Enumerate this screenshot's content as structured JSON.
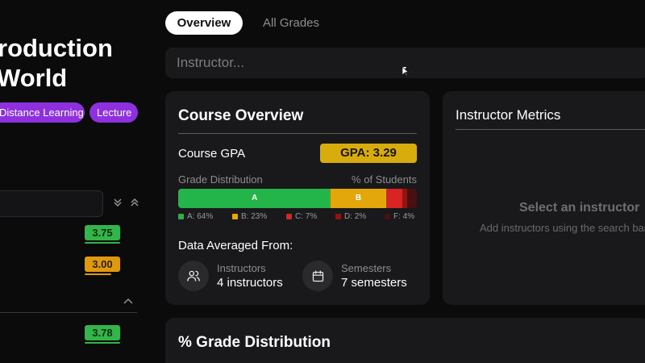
{
  "course": {
    "title_line1": "roduction",
    "title_line2": "World",
    "tags": [
      "Distance Learning",
      "Lecture"
    ]
  },
  "sidebar": {
    "sections": [
      {
        "gpa_values": [
          "3.75",
          "3.00"
        ]
      },
      {
        "gpa_values": [
          "3.78"
        ]
      }
    ]
  },
  "tabs": [
    {
      "label": "Overview",
      "active": true
    },
    {
      "label": "All Grades",
      "active": false
    }
  ],
  "search": {
    "placeholder": "Instructor..."
  },
  "overview": {
    "title": "Course Overview",
    "gpa_label": "Course GPA",
    "gpa_badge": "GPA: 3.29",
    "grade_dist_label": "Grade Distribution",
    "pct_label": "% of Students",
    "distribution": [
      {
        "grade": "A",
        "percent": 64,
        "bar_label": "A",
        "legend": "A: 64%",
        "color": "#23b54a"
      },
      {
        "grade": "B",
        "percent": 23,
        "bar_label": "B",
        "legend": "B: 23%",
        "color": "#e4a70b"
      },
      {
        "grade": "C",
        "percent": 7,
        "bar_label": "",
        "legend": "C: 7%",
        "color": "#d92424"
      },
      {
        "grade": "D",
        "percent": 2,
        "bar_label": "",
        "legend": "D: 2%",
        "color": "#8e1515"
      },
      {
        "grade": "F",
        "percent": 4,
        "bar_label": "",
        "legend": "F: 4%",
        "color": "#4a0f0f"
      }
    ],
    "averaged_label": "Data Averaged From:",
    "instructors_label": "Instructors",
    "instructors_value": "4 instructors",
    "semesters_label": "Semesters",
    "semesters_value": "7 semesters"
  },
  "metrics": {
    "title": "Instructor Metrics",
    "empty_title": "Select an instructor",
    "empty_sub": "Add instructors using the search bar"
  },
  "distribution_section": {
    "title": "% Grade Distribution"
  },
  "colors": {
    "accent_purple": "#8e2fe0",
    "gpa_gold": "#d9ac0e",
    "pill_green": "#33b54a",
    "pill_orange": "#e0990f"
  }
}
